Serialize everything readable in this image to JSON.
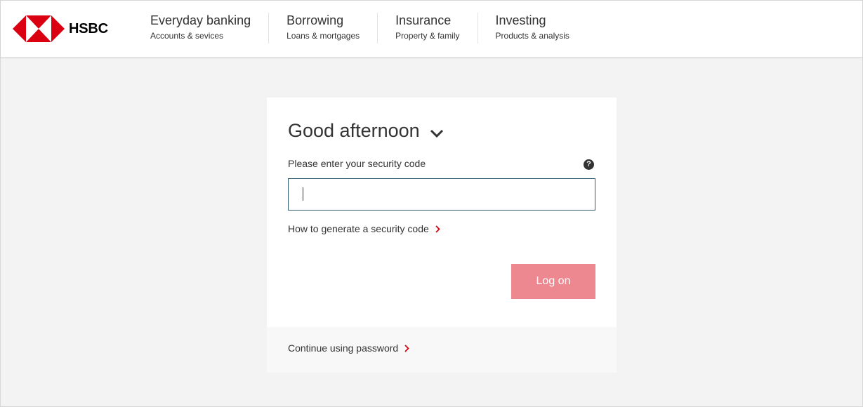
{
  "brand": {
    "name": "HSBC",
    "logo_red": "#db0011"
  },
  "nav": {
    "items": [
      {
        "title": "Everyday banking",
        "subtitle": "Accounts & sevices"
      },
      {
        "title": "Borrowing",
        "subtitle": "Loans & mortgages"
      },
      {
        "title": "Insurance",
        "subtitle": "Property & family"
      },
      {
        "title": "Investing",
        "subtitle": "Products & analysis"
      }
    ]
  },
  "login": {
    "greeting": "Good afternoon",
    "security_code_label": "Please enter your security code",
    "security_code_value": "",
    "help_icon_glyph": "?",
    "generate_code_link": "How to generate a security code",
    "logon_button": "Log on",
    "logon_button_color": "#ee8890",
    "continue_password_link": "Continue using password"
  }
}
